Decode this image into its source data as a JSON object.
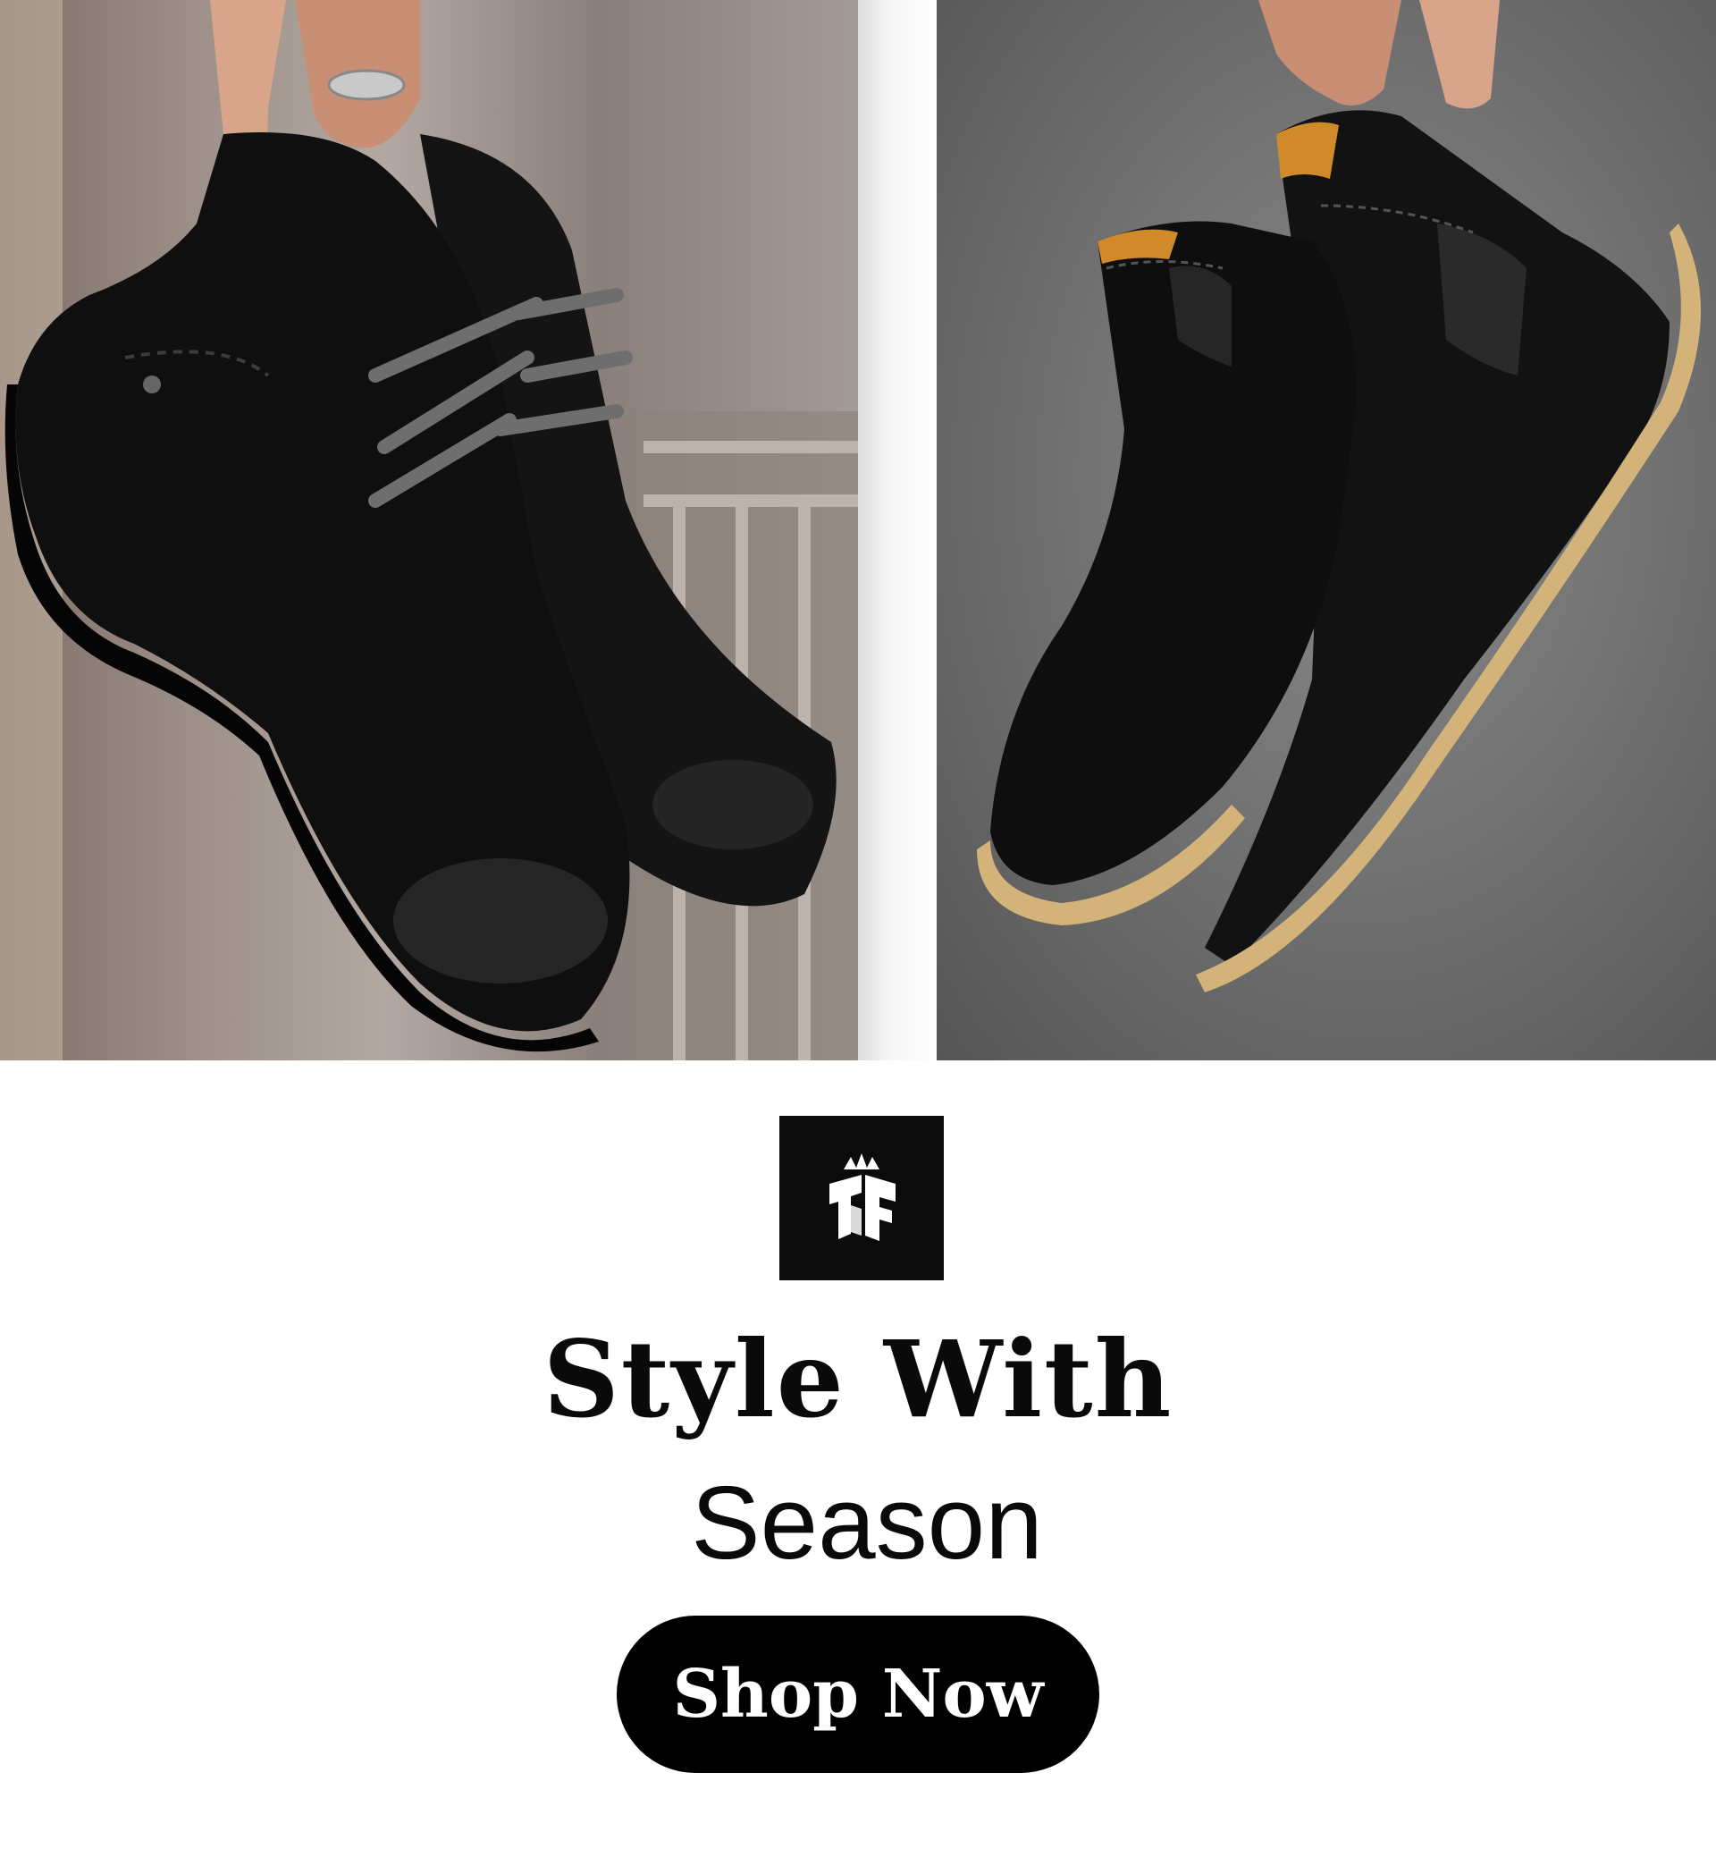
{
  "banner": {
    "images": [
      {
        "subject": "black suede lace-up chukka boots held by hand",
        "background": "blurred building facade"
      },
      {
        "subject": "black suede chelsea boots with gum sole held by hand",
        "background": "grey studio"
      }
    ],
    "logo": {
      "icon": "crown-monogram-icon",
      "background_color": "#0b0b0b"
    },
    "headline": {
      "line1": "Style With",
      "line2": "Season"
    },
    "cta": {
      "label": "Shop Now",
      "background_color": "#000000",
      "text_color": "#ffffff"
    }
  }
}
